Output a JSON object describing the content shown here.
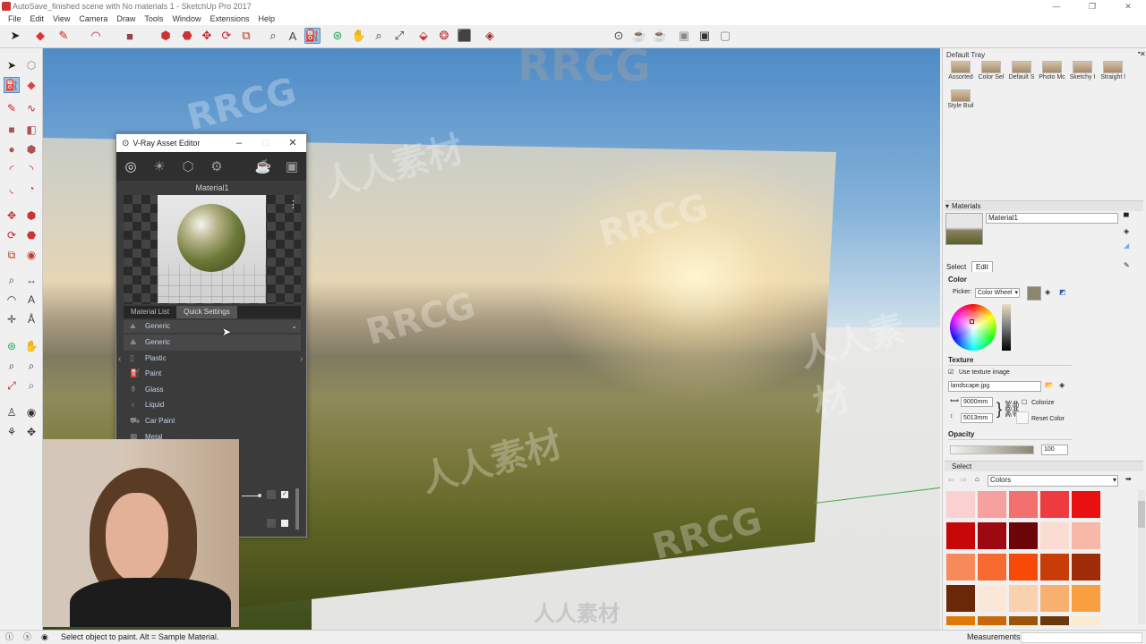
{
  "window": {
    "title": "AutoSave_finished scene with No materials 1 - SketchUp Pro 2017",
    "controls": [
      "—",
      "❐",
      "✕"
    ]
  },
  "menu": [
    "File",
    "Edit",
    "View",
    "Camera",
    "Draw",
    "Tools",
    "Window",
    "Extensions",
    "Help"
  ],
  "watermark": {
    "brand": "RRCG",
    "cn": "人人素材",
    "footer_cn": "人人素材"
  },
  "vray_editor": {
    "title": "V-Ray Asset Editor",
    "material_name": "Material1",
    "tabs": [
      "Material List",
      "Quick Settings"
    ],
    "dropdown_value": "Generic",
    "presets": [
      "Generic",
      "Plastic",
      "Paint",
      "Glass",
      "Liquid",
      "Car Paint",
      "Metal"
    ]
  },
  "default_tray": {
    "title": "Default Tray",
    "styles": [
      "Assorted",
      "Color Sel",
      "Default S",
      "Photo Mc",
      "Sketchy I",
      "Straight l",
      "Style Buil"
    ]
  },
  "materials_panel": {
    "header": "Materials",
    "material_name": "Material1",
    "tabs": [
      "Select",
      "Edit"
    ],
    "color_label": "Color",
    "picker_label": "Picker:",
    "picker_value": "Color Wheel",
    "texture_label": "Texture",
    "use_texture_label": "Use texture image",
    "use_texture_checked": true,
    "texture_file": "landscape.jpg",
    "width": "9000mm",
    "height": "5013mm",
    "colorize_label": "Colorize",
    "reset_color_label": "Reset Color",
    "opacity_label": "Opacity",
    "opacity_value": "100"
  },
  "select_panel": {
    "header": "Select",
    "library": "Colors",
    "swatches": [
      "#fbd0d0",
      "#f7a0a0",
      "#f37070",
      "#ef3a40",
      "#e81010",
      "#c80808",
      "#9e0810",
      "#6b0508",
      "#fbdcd0",
      "#f7b8a8",
      "#f78a5a",
      "#f76a30",
      "#f74a08",
      "#c83c08",
      "#9e2c08",
      "#6b2808",
      "#fbe8d8",
      "#fbd2b0",
      "#f8b070",
      "#f8a040",
      "#e07808",
      "#c86808",
      "#9e5408",
      "#6b3808",
      "#fbecd0"
    ]
  },
  "status": {
    "message": "Select object to paint. Alt = Sample Material.",
    "measurements_label": "Measurements"
  }
}
